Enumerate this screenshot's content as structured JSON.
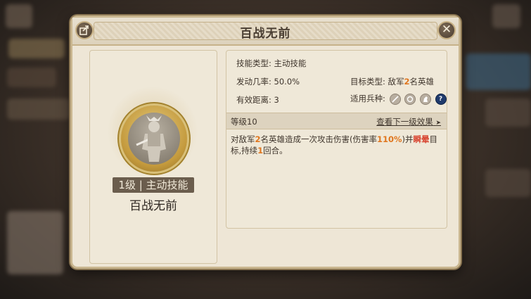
{
  "dialog": {
    "title": "百战无前",
    "share_icon": "share-icon",
    "close_icon": "close-icon",
    "close_glyph": "✕"
  },
  "skill_card": {
    "tag": "1级 | 主动技能",
    "name": "百战无前"
  },
  "info": {
    "type_label": "技能类型:",
    "type_value": "主动技能",
    "rate_label": "发动几率:",
    "rate_value": "50.0%",
    "target_label": "目标类型:",
    "target_prefix": "敌军",
    "target_count": "2",
    "target_suffix": "名英雄",
    "range_label": "有效距离:",
    "range_value": "3",
    "units_label": "适用兵种:",
    "unit_icons": [
      "spear-icon",
      "shield-icon",
      "horse-icon",
      "question-icon"
    ],
    "question_glyph": "?"
  },
  "level": {
    "label": "等级10",
    "next_link": "查看下一级效果",
    "arrow_glyph": "➤"
  },
  "description": {
    "p1": "对敌军",
    "n1": "2",
    "p2": "名英雄造成一次攻击伤害(伤害率",
    "n2": "110%",
    "p3": ")并",
    "effect": "瞬晕",
    "p4": "目标,持续",
    "n3": "1",
    "p5": "回合。"
  },
  "colors": {
    "highlight_orange": "#e0761e",
    "highlight_red": "#d84430",
    "help_icon_blue": "#1f3a6c"
  }
}
